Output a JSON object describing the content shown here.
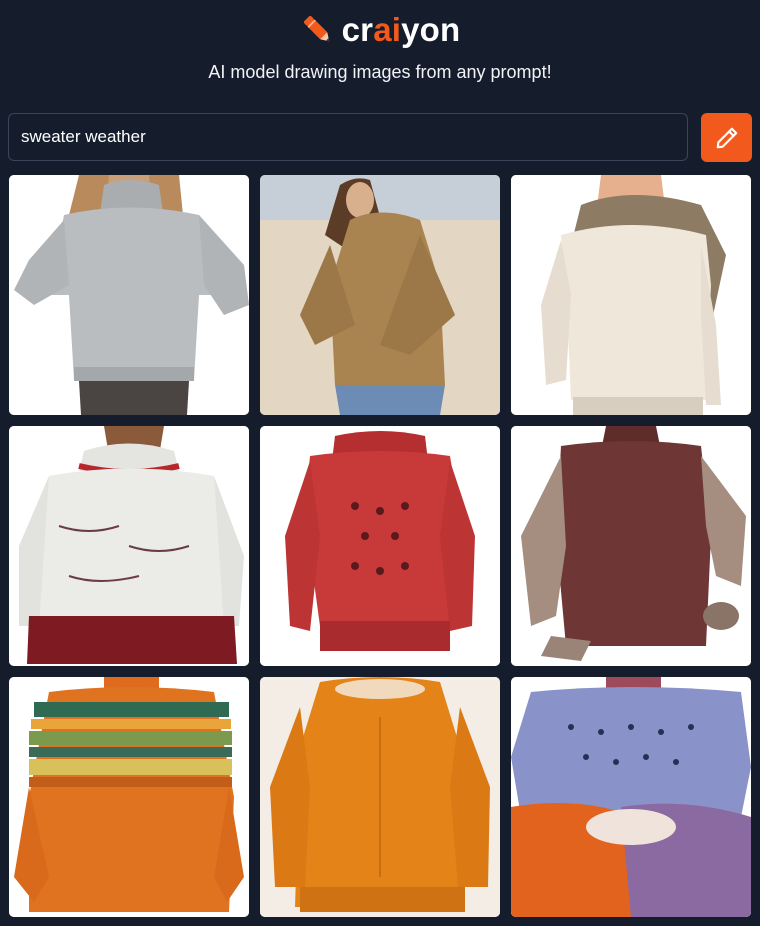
{
  "header": {
    "logo_text_before": "cr",
    "logo_text_accent": "ai",
    "logo_text_after": "yon",
    "tagline": "AI model drawing images from any prompt!"
  },
  "prompt": {
    "value": "sweater weather"
  },
  "colors": {
    "background": "#151c2c",
    "accent": "#f25a1d",
    "input_border": "#3b4458"
  },
  "icons": {
    "logo": "pencil-icon",
    "draw_button": "pencil-edit-icon"
  },
  "results": [
    {
      "id": "result-1",
      "sweater_color": "#b9bdbf",
      "background": "#ffffff"
    },
    {
      "id": "result-2",
      "sweater_color": "#a98450",
      "background": "#e3d6c2"
    },
    {
      "id": "result-3",
      "sweater_color": "#efe7da",
      "background": "#ffffff"
    },
    {
      "id": "result-4",
      "sweater_color": "#ebebe8",
      "background": "#ffffff"
    },
    {
      "id": "result-5",
      "sweater_color": "#c8393a",
      "background": "#ffffff"
    },
    {
      "id": "result-6",
      "sweater_color": "#6e3634",
      "background": "#ffffff"
    },
    {
      "id": "result-7",
      "sweater_color": "#e0731f",
      "background": "#ffffff"
    },
    {
      "id": "result-8",
      "sweater_color": "#e48318",
      "background": "#f3ede6"
    },
    {
      "id": "result-9",
      "sweater_color": "#8993c9",
      "background": "#ffffff"
    }
  ]
}
